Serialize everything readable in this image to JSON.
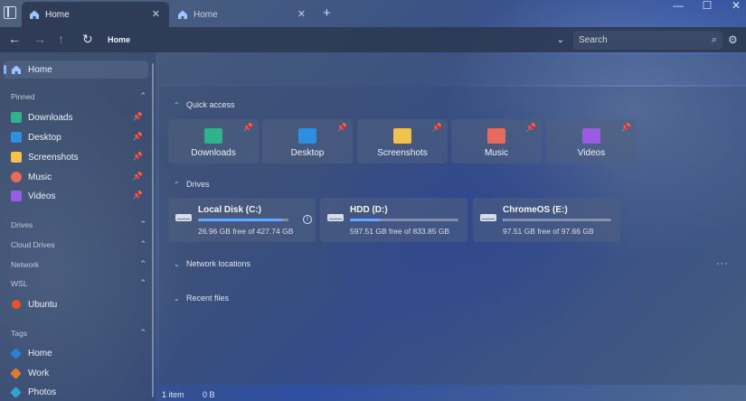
{
  "titlebar": {
    "tabs": [
      {
        "label": "Home",
        "active": true
      },
      {
        "label": "Home",
        "active": false
      }
    ],
    "new_tab": "+",
    "controls": {
      "minimize": "—",
      "maximize": "☐",
      "close": "✕"
    }
  },
  "addressbar": {
    "path": "Home",
    "search_placeholder": "Search"
  },
  "sidebar": {
    "home": {
      "label": "Home"
    },
    "pinned_header": "Pinned",
    "pinned": [
      {
        "label": "Downloads",
        "icon": "downloads-icon",
        "color": "#2fb48a"
      },
      {
        "label": "Desktop",
        "icon": "desktop-icon",
        "color": "#2e8fe0"
      },
      {
        "label": "Screenshots",
        "icon": "folder-icon",
        "color": "#f2c14e"
      },
      {
        "label": "Music",
        "icon": "music-icon",
        "color": "#e86a5a"
      },
      {
        "label": "Videos",
        "icon": "videos-icon",
        "color": "#9a5ce0"
      }
    ],
    "sections": [
      "Drives",
      "Cloud Drives",
      "Network",
      "WSL"
    ],
    "wsl_items": [
      {
        "label": "Ubuntu",
        "icon": "ubuntu-icon",
        "color": "#e95420"
      }
    ],
    "tags_header": "Tags",
    "tags": [
      {
        "label": "Home",
        "color": "#2a7fd6"
      },
      {
        "label": "Work",
        "color": "#e07b2e"
      },
      {
        "label": "Photos",
        "color": "#2fa3d6"
      }
    ]
  },
  "main": {
    "quick_access": {
      "title": "Quick access",
      "items": [
        {
          "label": "Downloads",
          "color": "#2fb48a"
        },
        {
          "label": "Desktop",
          "color": "#2e8fe0"
        },
        {
          "label": "Screenshots",
          "color": "#f2c14e"
        },
        {
          "label": "Music",
          "color": "#e86a5a"
        },
        {
          "label": "Videos",
          "color": "#9a5ce0"
        }
      ]
    },
    "drives": {
      "title": "Drives",
      "items": [
        {
          "name": "Local Disk (C:)",
          "free": "26.96 GB free of 427.74 GB",
          "used_fraction": 0.94
        },
        {
          "name": "HDD (D:)",
          "free": "597.51 GB free of 833.85 GB",
          "used_fraction": 0.28
        },
        {
          "name": "ChromeOS (E:)",
          "free": "97.51 GB free of 97.66 GB",
          "used_fraction": 0.02
        }
      ]
    },
    "network_locations": {
      "title": "Network locations"
    },
    "recent_files": {
      "title": "Recent files"
    }
  },
  "status": {
    "items": "1 item",
    "size": "0 B"
  }
}
